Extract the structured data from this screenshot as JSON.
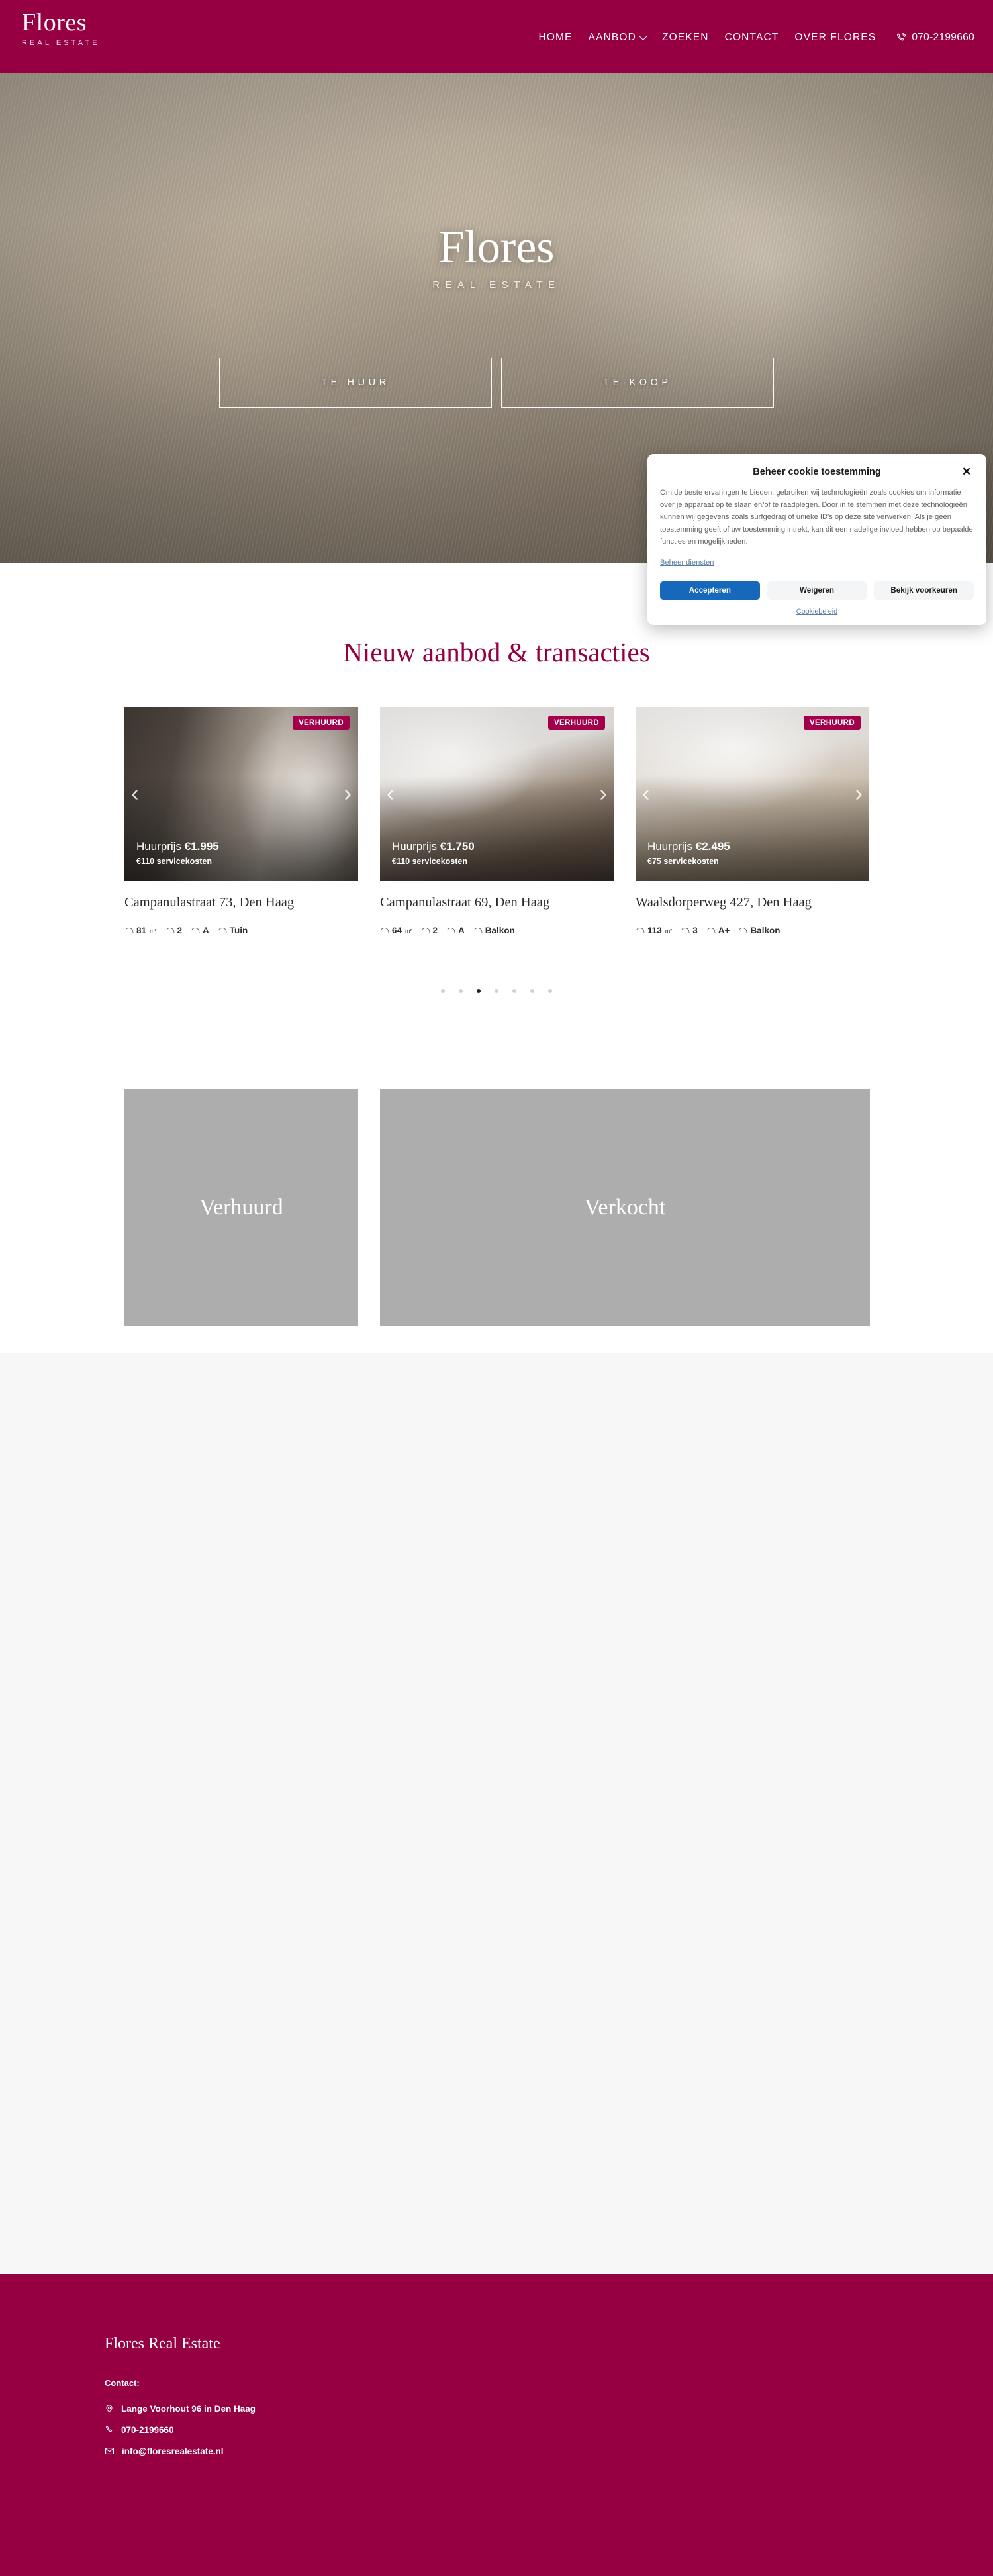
{
  "header": {
    "brand_name": "Flores",
    "brand_sub": "REAL ESTATE",
    "nav": [
      {
        "label": "HOME",
        "has_caret": false
      },
      {
        "label": "AANBOD",
        "has_caret": true
      },
      {
        "label": "ZOEKEN",
        "has_caret": false
      },
      {
        "label": "CONTACT",
        "has_caret": false
      },
      {
        "label": "OVER FLORES",
        "has_caret": false
      }
    ],
    "phone": "070-2199660"
  },
  "hero": {
    "title": "Flores",
    "subtitle": "REAL ESTATE",
    "button_rent": "TE HUUR",
    "button_buy": "TE KOOP"
  },
  "listings": {
    "section_title": "Nieuw aanbod & transacties",
    "badge_label": "VERHUURD",
    "arrow_prev": "‹",
    "arrow_next": "›",
    "price_prefix": "Huurprijs",
    "cards": [
      {
        "badge": "VERHUURD",
        "price_prefix": "Huurprijs",
        "price": "€1.995",
        "service_costs": "€110 servicekosten",
        "address": "Campanulastraat 73, Den Haag",
        "specs": [
          {
            "value": "81",
            "unit": "m²"
          },
          {
            "value": "2",
            "unit": ""
          },
          {
            "value": "A",
            "unit": ""
          },
          {
            "value": "Tuin",
            "unit": ""
          }
        ]
      },
      {
        "badge": "VERHUURD",
        "price_prefix": "Huurprijs",
        "price": "€1.750",
        "service_costs": "€110 servicekosten",
        "address": "Campanulastraat 69, Den Haag",
        "specs": [
          {
            "value": "64",
            "unit": "m²"
          },
          {
            "value": "2",
            "unit": ""
          },
          {
            "value": "A",
            "unit": ""
          },
          {
            "value": "Balkon",
            "unit": ""
          }
        ]
      },
      {
        "badge": "VERHUURD",
        "price_prefix": "Huurprijs",
        "price": "€2.495",
        "service_costs": "€75 servicekosten",
        "address": "Waalsdorperweg 427, Den Haag",
        "specs": [
          {
            "value": "113",
            "unit": "m²"
          },
          {
            "value": "3",
            "unit": ""
          },
          {
            "value": "A+",
            "unit": ""
          },
          {
            "value": "Balkon",
            "unit": ""
          }
        ]
      }
    ],
    "dots": {
      "count": 7,
      "active_index": 2
    },
    "tiles": [
      {
        "label": "Verhuurd"
      },
      {
        "label": "Verkocht"
      }
    ]
  },
  "footer": {
    "brand": "Flores Real Estate",
    "contact_label": "Contact:",
    "items": [
      {
        "icon": "location-pin-icon",
        "text": "Lange Voorhout 96 in Den Haag"
      },
      {
        "icon": "phone-icon",
        "text": "070-2199660"
      },
      {
        "icon": "envelope-icon",
        "text": "info@floresrealestate.nl"
      }
    ]
  },
  "cookie_dialog": {
    "title": "Beheer cookie toestemming",
    "close_label": "✕",
    "body": "Om de beste ervaringen te bieden, gebruiken wij technologieën zoals cookies om informatie over je apparaat op te slaan en/of te raadplegen. Door in te stemmen met deze technologieën kunnen wij gegevens zoals surfgedrag of unieke ID's op deze site verwerken. Als je geen toestemming geeft of uw toestemming intrekt, kan dit een nadelige invloed hebben op bepaalde functies en mogelijkheden.",
    "manage_link": "Beheer diensten",
    "accept_label": "Accepteren",
    "deny_label": "Weigeren",
    "preferences_label": "Bekijk voorkeuren",
    "policy_link": "Cookiebeleid"
  },
  "colors": {
    "brand_burgundy": "#960042",
    "badge_pink": "#a3004b",
    "accept_blue": "#1668bb",
    "tile_grey": "#adadad",
    "band_grey": "#f7f7f7"
  }
}
